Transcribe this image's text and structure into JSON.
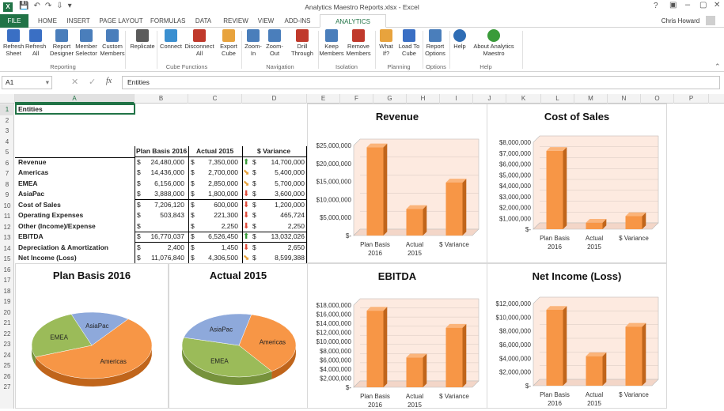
{
  "window": {
    "title": "Analytics Maestro Reports.xlsx - Excel",
    "user": "Chris Howard"
  },
  "tabs": [
    "FILE",
    "HOME",
    "INSERT",
    "PAGE LAYOUT",
    "FORMULAS",
    "DATA",
    "REVIEW",
    "VIEW",
    "ADD-INS",
    "ANALYTICS MAESTRO"
  ],
  "ribbon": {
    "buttons": [
      {
        "l1": "Refresh",
        "l2": "Sheet",
        "icon": "refresh-sheet-icon"
      },
      {
        "l1": "Refresh",
        "l2": "All",
        "icon": "refresh-all-icon"
      },
      {
        "l1": "Report",
        "l2": "Designer",
        "icon": "report-designer-icon"
      },
      {
        "l1": "Member",
        "l2": "Selector",
        "icon": "member-selector-icon"
      },
      {
        "l1": "Custom",
        "l2": "Members",
        "icon": "custom-members-icon"
      },
      {
        "l1": "Replicate",
        "l2": "",
        "icon": "replicate-icon"
      },
      {
        "l1": "Connect",
        "l2": "",
        "icon": "connect-icon"
      },
      {
        "l1": "Disconnect",
        "l2": "All",
        "icon": "disconnect-icon"
      },
      {
        "l1": "Export",
        "l2": "Cube",
        "icon": "export-cube-icon"
      },
      {
        "l1": "Zoom-",
        "l2": "In",
        "icon": "zoom-in-icon"
      },
      {
        "l1": "Zoom-",
        "l2": "Out",
        "icon": "zoom-out-icon"
      },
      {
        "l1": "Drill",
        "l2": "Through",
        "icon": "drill-through-icon"
      },
      {
        "l1": "Keep",
        "l2": "Members",
        "icon": "keep-members-icon"
      },
      {
        "l1": "Remove",
        "l2": "Members",
        "icon": "remove-members-icon"
      },
      {
        "l1": "What",
        "l2": "If?",
        "icon": "what-if-icon"
      },
      {
        "l1": "Load To",
        "l2": "Cube",
        "icon": "load-to-cube-icon"
      },
      {
        "l1": "Report",
        "l2": "Options",
        "icon": "report-options-icon"
      },
      {
        "l1": "Help",
        "l2": "",
        "icon": "help-icon"
      },
      {
        "l1": "About Analytics",
        "l2": "Maestro",
        "icon": "about-icon"
      }
    ],
    "groups": [
      "Reporting",
      "Cube Functions",
      "Navigation",
      "Isolation",
      "Planning",
      "Options",
      "Help"
    ]
  },
  "formula": {
    "namebox": "A1",
    "fx": "fx",
    "value": "Entities"
  },
  "columns": [
    "A",
    "B",
    "C",
    "D",
    "E",
    "F",
    "G",
    "H",
    "I",
    "J",
    "K",
    "L",
    "M",
    "N",
    "O",
    "P"
  ],
  "rows": [
    "1",
    "2",
    "3",
    "4",
    "5",
    "6",
    "7",
    "8",
    "9",
    "10",
    "11",
    "12",
    "13",
    "14",
    "15",
    "16",
    "17",
    "18",
    "19",
    "20",
    "21",
    "22",
    "23",
    "24",
    "25",
    "26",
    "27"
  ],
  "sheet": {
    "a1": "Entities",
    "headers": [
      "Plan Basis 2016",
      "Actual 2015",
      "$ Variance"
    ],
    "currency": "$",
    "lines": [
      {
        "label": "Revenue",
        "plan": "24,480,000",
        "actual": "7,350,000",
        "arrow": "up",
        "var": "14,700,000"
      },
      {
        "label": "Americas",
        "plan": "14,436,000",
        "actual": "2,700,000",
        "arrow": "down-right",
        "var": "5,400,000"
      },
      {
        "label": "EMEA",
        "plan": "6,156,000",
        "actual": "2,850,000",
        "arrow": "down-right",
        "var": "5,700,000"
      },
      {
        "label": "AsiaPac",
        "plan": "3,888,000",
        "actual": "1,800,000",
        "arrow": "down",
        "var": "3,600,000"
      },
      {
        "label": "Cost of Sales",
        "plan": "7,206,120",
        "actual": "600,000",
        "arrow": "down",
        "var": "1,200,000"
      },
      {
        "label": "Operating Expenses",
        "plan": "503,843",
        "actual": "221,300",
        "arrow": "down",
        "var": "465,724"
      },
      {
        "label": "Other (Income)/Expense",
        "plan": "",
        "actual": "2,250",
        "arrow": "down",
        "var": "2,250"
      },
      {
        "label": "EBITDA",
        "plan": "16,770,037",
        "actual": "6,526,450",
        "arrow": "up",
        "var": "13,032,026"
      },
      {
        "label": "Depreciation & Amortization",
        "plan": "2,400",
        "actual": "1,450",
        "arrow": "down",
        "var": "2,650"
      },
      {
        "label": "Net Income (Loss)",
        "plan": "11,076,840",
        "actual": "4,306,500",
        "arrow": "down-right",
        "var": "8,599,388"
      }
    ]
  },
  "colors": {
    "excel_green": "#217346",
    "bar": "#f79646",
    "bar_dark": "#c0651b",
    "americas": "#f79646",
    "emea": "#9bbb59",
    "asiapac": "#8ea9db"
  },
  "chart_data": [
    {
      "type": "bar",
      "title": "Revenue",
      "categories": [
        "Plan Basis 2016",
        "Actual 2015",
        "$ Variance"
      ],
      "values": [
        24480000,
        7350000,
        14700000
      ],
      "ylim": [
        0,
        25000000
      ],
      "ticks": [
        "$-",
        "$5,000,000",
        "$10,000,000",
        "$15,000,000",
        "$20,000,000",
        "$25,000,000"
      ]
    },
    {
      "type": "bar",
      "title": "Cost of Sales",
      "categories": [
        "Plan Basis 2016",
        "Actual 2015",
        "$ Variance"
      ],
      "values": [
        7206120,
        600000,
        1200000
      ],
      "ylim": [
        0,
        8000000
      ],
      "ticks": [
        "$-",
        "$1,000,000",
        "$2,000,000",
        "$3,000,000",
        "$4,000,000",
        "$5,000,000",
        "$6,000,000",
        "$7,000,000",
        "$8,000,000"
      ]
    },
    {
      "type": "bar",
      "title": "EBITDA",
      "categories": [
        "Plan Basis 2016",
        "Actual 2015",
        "$ Variance"
      ],
      "values": [
        16770037,
        6526450,
        13032026
      ],
      "ylim": [
        0,
        18000000
      ],
      "ticks": [
        "$-",
        "$2,000,000",
        "$4,000,000",
        "$6,000,000",
        "$8,000,000",
        "$10,000,000",
        "$12,000,000",
        "$14,000,000",
        "$16,000,000",
        "$18,000,000"
      ]
    },
    {
      "type": "bar",
      "title": "Net Income (Loss)",
      "categories": [
        "Plan Basis 2016",
        "Actual 2015",
        "$ Variance"
      ],
      "values": [
        11076840,
        4306500,
        8599388
      ],
      "ylim": [
        0,
        12000000
      ],
      "ticks": [
        "$-",
        "$2,000,000",
        "$4,000,000",
        "$6,000,000",
        "$8,000,000",
        "$10,000,000",
        "$12,000,000"
      ]
    },
    {
      "type": "pie",
      "title": "Plan Basis 2016",
      "labels": [
        "Americas",
        "EMEA",
        "AsiaPac"
      ],
      "values": [
        14436000,
        6156000,
        3888000
      ]
    },
    {
      "type": "pie",
      "title": "Actual 2015",
      "labels": [
        "Americas",
        "EMEA",
        "AsiaPac"
      ],
      "values": [
        2700000,
        2850000,
        1800000
      ]
    }
  ]
}
